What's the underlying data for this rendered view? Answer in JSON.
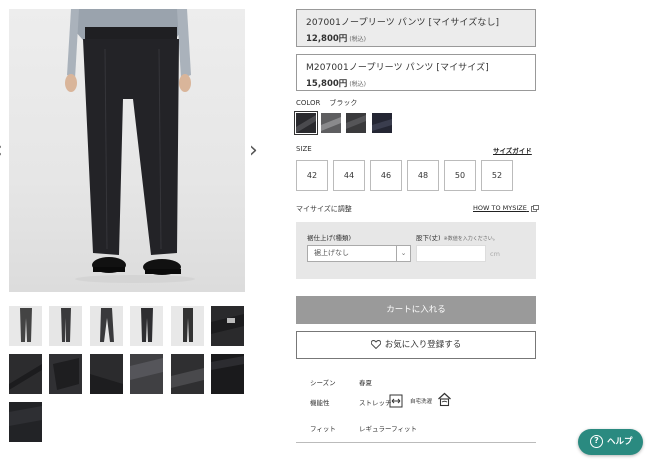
{
  "variants": [
    {
      "name": "207001ノープリーツ パンツ [マイサイズなし]",
      "price": "12,800円",
      "tax": "(税込)",
      "selected": true
    },
    {
      "name": "M207001ノープリーツ パンツ [マイサイズ]",
      "price": "15,800円",
      "tax": "(税込)",
      "selected": false
    }
  ],
  "color": {
    "label": "COLOR",
    "selected_name": "ブラック",
    "swatches": [
      "#2a2a2e",
      "#5e5e60",
      "#3a3a3c",
      "#242633"
    ]
  },
  "size": {
    "label": "SIZE",
    "guide_link": "サイズガイド",
    "options": [
      "42",
      "44",
      "46",
      "48",
      "50",
      "52"
    ]
  },
  "mysize": {
    "label": "マイサイズに調整",
    "link": "HOW TO MYSIZE"
  },
  "hem": {
    "finish_label": "裾仕上げ(種類)",
    "length_label": "股下(丈)",
    "length_note": "※数値を入力ください。",
    "select_value": "裾上げなし",
    "unit": "cm"
  },
  "cart_button": "カートに入れる",
  "fav_button": "お気に入り登録する",
  "specs": {
    "season_label": "シーズン",
    "season_value": "春夏",
    "function_label": "機能性",
    "stretch": "ストレッチ",
    "washable": "自宅洗濯",
    "fit_label": "フィット",
    "fit_value": "レギュラーフィット"
  },
  "help_button": "ヘルプ"
}
